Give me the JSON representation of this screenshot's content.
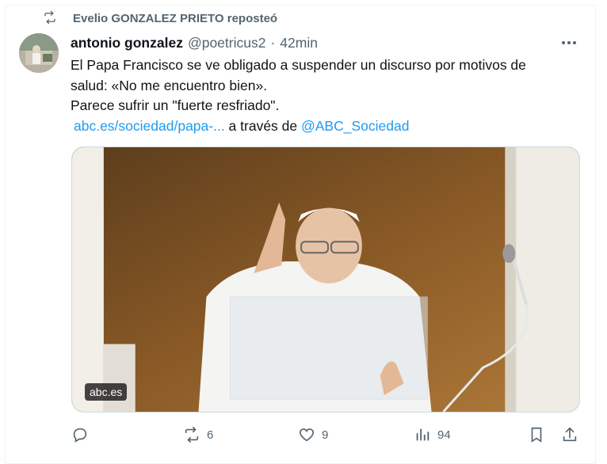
{
  "repost": {
    "text": "Evelio GONZALEZ PRIETO reposteó",
    "icon": "repost-icon"
  },
  "tweet": {
    "author_name": "antonio gonzalez",
    "handle": "@poetricus2",
    "separator": "·",
    "time": "42min",
    "body_line1": "El Papa Francisco se ve obligado a suspender un discurso por motivos de",
    "body_line2": "salud: «No me encuentro bien».",
    "body_line3": "Parece sufrir un \"fuerte resfriado\".",
    "link_text": "abc.es/sociedad/papa-...",
    "via_text": " a través de ",
    "mention": "@ABC_Sociedad",
    "media_badge": "abc.es"
  },
  "actions": {
    "reply_icon": "reply-icon",
    "retweet_count": "6",
    "like_count": "9",
    "views_count": "94",
    "bookmark_icon": "bookmark-icon",
    "share_icon": "share-icon"
  },
  "colors": {
    "accent": "#1d9bf0",
    "muted": "#536471",
    "text": "#0f1419"
  }
}
